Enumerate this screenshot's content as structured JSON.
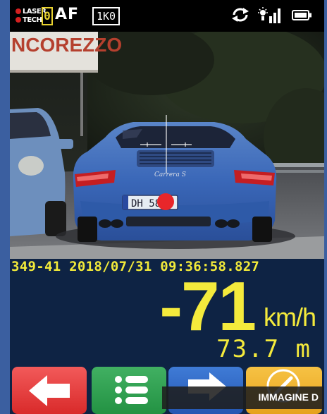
{
  "status_bar": {
    "brand_line1": "LASER",
    "brand_line2": "TECH",
    "counter": "0",
    "focus_mode": "AF",
    "range_mode": "1K0",
    "icons": [
      "laser-tech-logo",
      "sync-icon",
      "signal-icon",
      "battery-icon"
    ]
  },
  "camera": {
    "sign_text": "NCOREZZO",
    "plate_text": "DH 58",
    "badge_text": "Carrera S",
    "target_marker_color": "#e8262a"
  },
  "info": {
    "timestamp": "349-41 2018/07/31 09:36:58.827",
    "speed": "-71",
    "speed_unit": "km/h",
    "distance": "73.7 m",
    "text_color": "#f4ea3c"
  },
  "buttons": {
    "back_icon": "arrow-left-icon",
    "list_icon": "list-icon",
    "next_icon": "arrow-right-icon",
    "edit_icon": "pencil-circle-icon",
    "banner_text": "IMMAGINE D"
  }
}
